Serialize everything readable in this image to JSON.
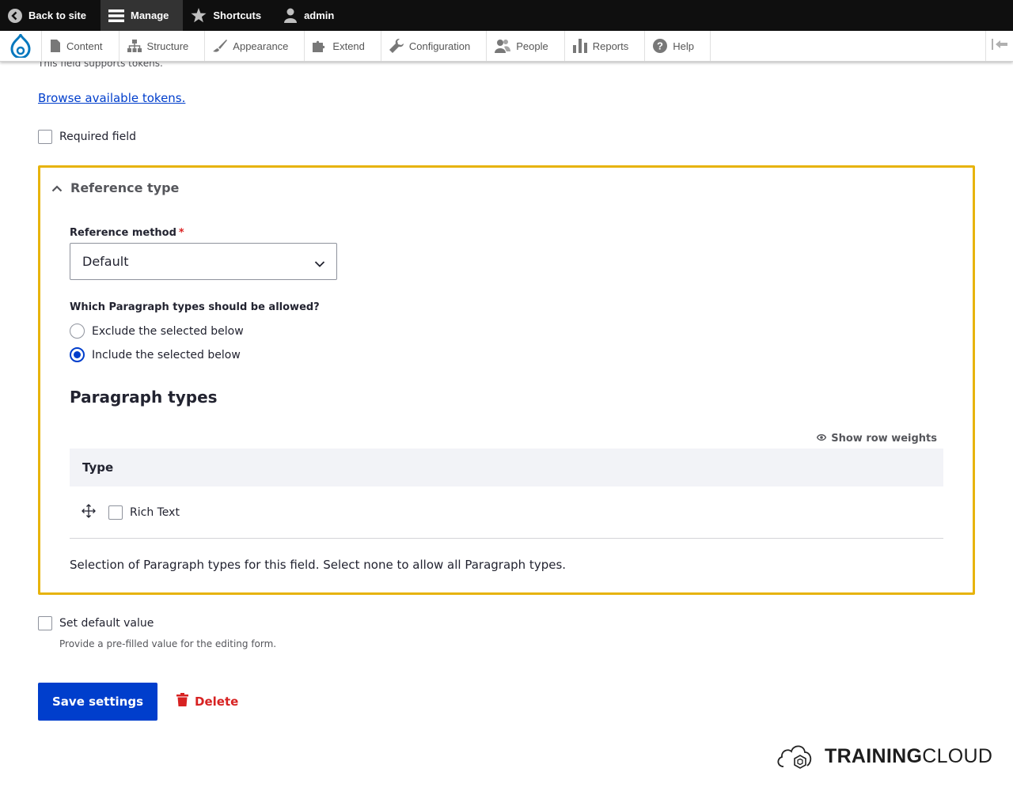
{
  "toolbar": {
    "back_label": "Back to site",
    "manage_label": "Manage",
    "shortcuts_label": "Shortcuts",
    "user_label": "admin"
  },
  "tray": {
    "items": [
      "Content",
      "Structure",
      "Appearance",
      "Extend",
      "Configuration",
      "People",
      "Reports",
      "Help"
    ]
  },
  "form": {
    "token_note": "This field supports tokens.",
    "browse_tokens": "Browse available tokens.",
    "required_label": "Required field",
    "fieldset": {
      "legend": "Reference type",
      "reference_method_label": "Reference method",
      "required_marker": "*",
      "reference_method_value": "Default",
      "allowed_question": "Which Paragraph types should be allowed?",
      "radio_exclude": "Exclude the selected below",
      "radio_include": "Include the selected below",
      "selected_radio": "include",
      "paragraph_types_heading": "Paragraph types",
      "show_row_weights": "Show row weights",
      "table_header_type": "Type",
      "rows": [
        {
          "label": "Rich Text",
          "checked": false
        }
      ],
      "description": "Selection of Paragraph types for this field. Select none to allow all Paragraph types."
    },
    "default_value_label": "Set default value",
    "default_value_desc": "Provide a pre-filled value for the editing form.",
    "save_button": "Save settings",
    "delete_button": "Delete"
  },
  "brand": {
    "bold": "TRAINING",
    "light": "CLOUD"
  },
  "colors": {
    "accent": "#003ecc",
    "fieldset_border": "#e7b30b",
    "danger": "#d72222"
  }
}
